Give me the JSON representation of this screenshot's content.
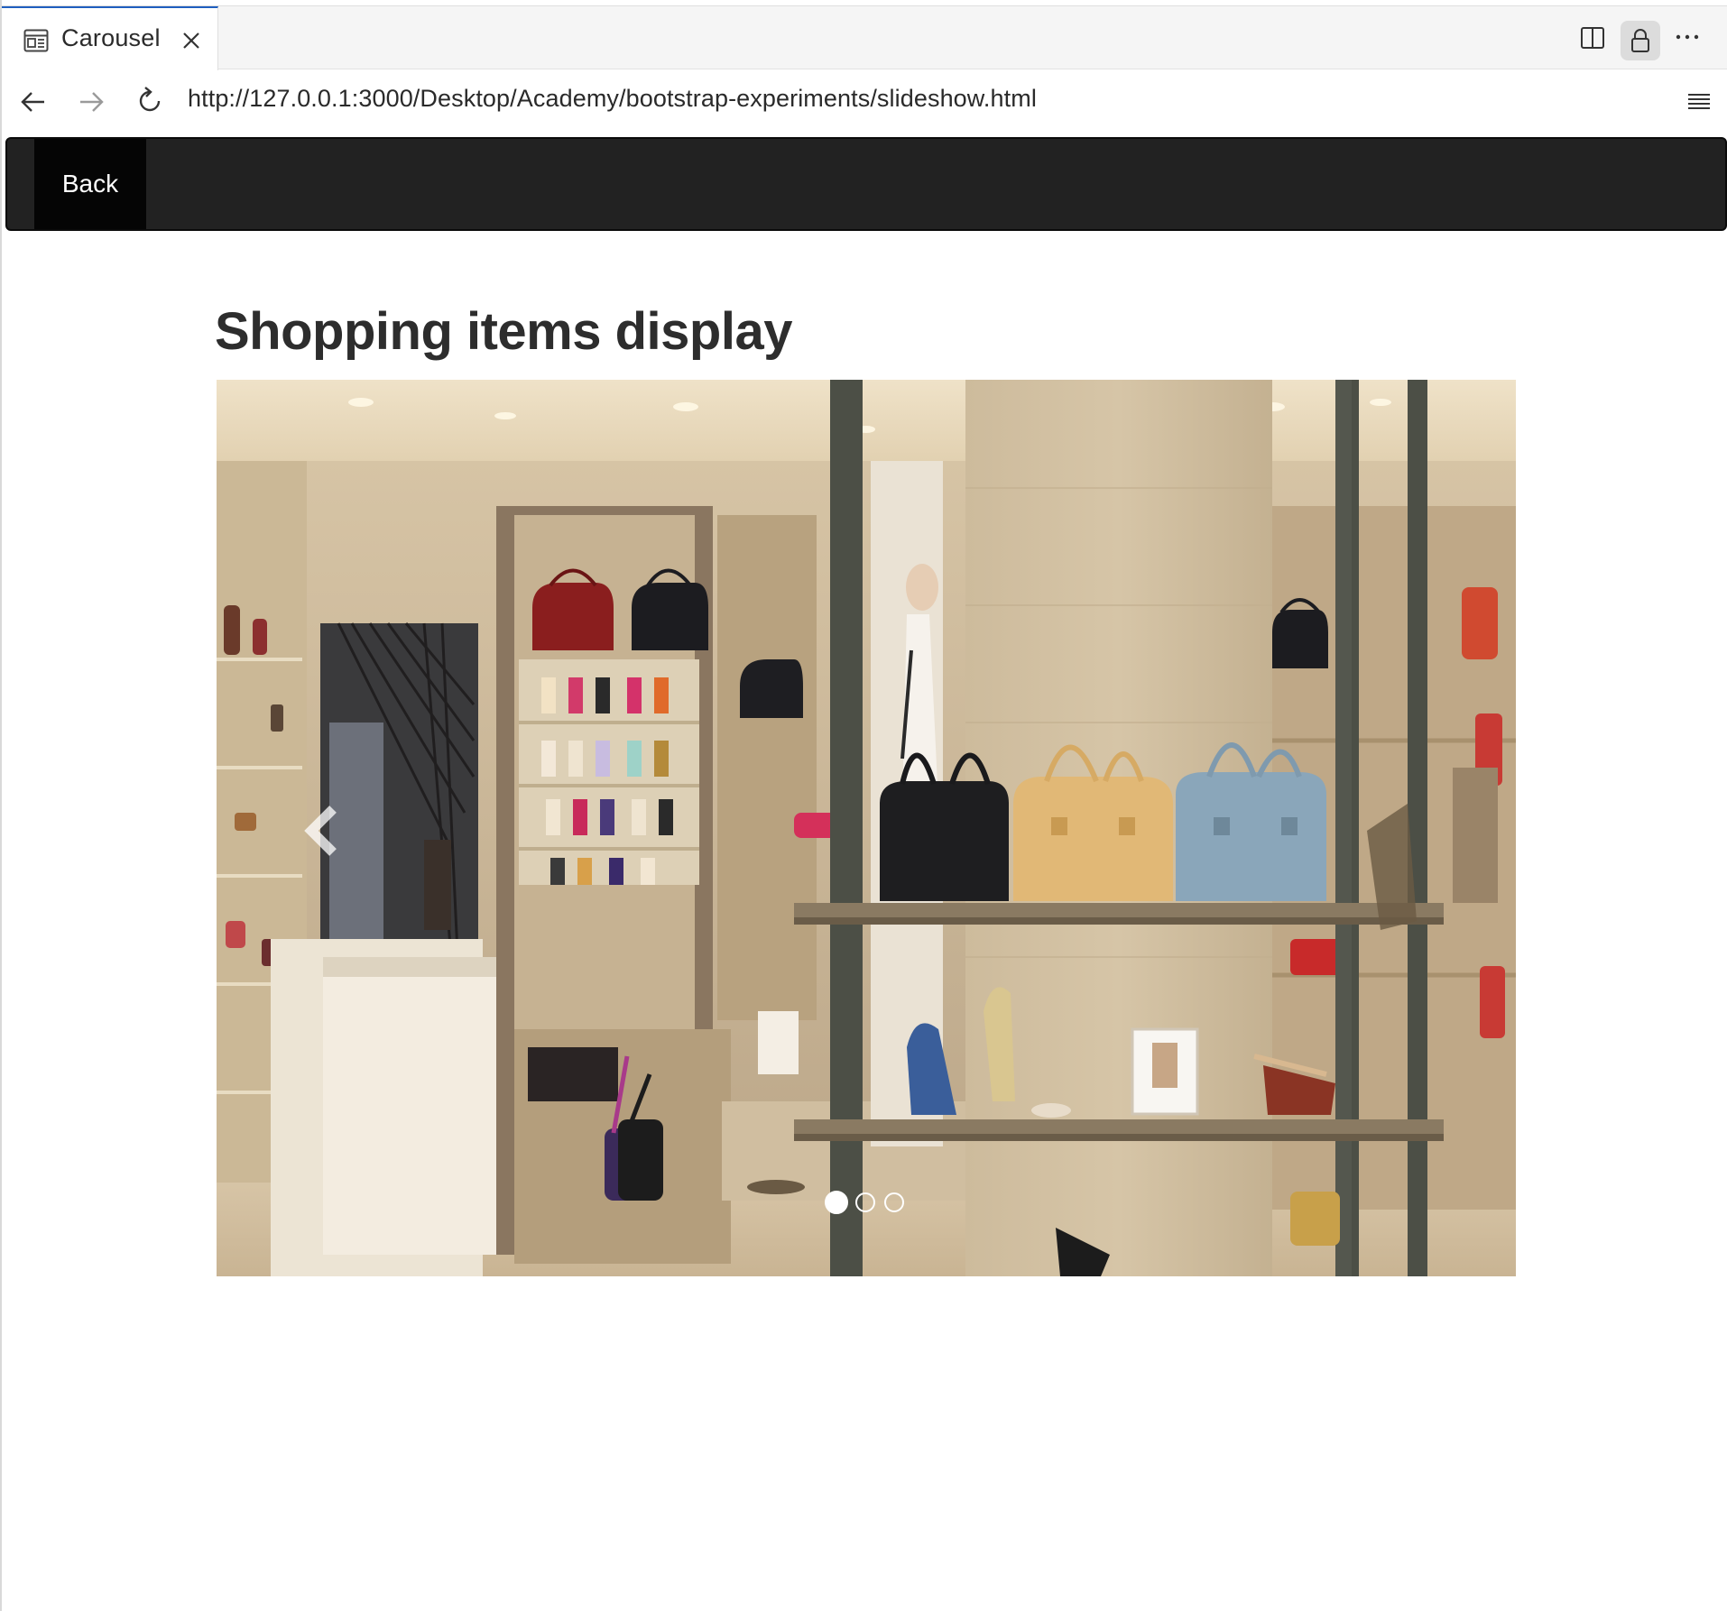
{
  "browser": {
    "tab": {
      "title": "Carousel",
      "icon": "page-layout-icon"
    },
    "address_bar": {
      "url": "http://127.0.0.1:3000/Desktop/Academy/bootstrap-experiments/slideshow.html"
    },
    "toolbar_icons": [
      "back-arrow-icon",
      "forward-arrow-icon",
      "reload-icon",
      "split-view-icon",
      "lock-icon",
      "more-icon",
      "hamburger-menu-icon"
    ]
  },
  "page": {
    "nav": {
      "back_label": "Back"
    },
    "heading": "Shopping items display",
    "carousel": {
      "image_description": "boutique-interior-handbags-shoes",
      "slide_count": 3,
      "active_index": 0,
      "prev_icon": "chevron-left-icon",
      "next_icon": "chevron-right-icon"
    }
  },
  "colors": {
    "nav_bg": "#222222",
    "back_btn_bg": "#050505",
    "tab_accent": "#1f5fbf"
  }
}
